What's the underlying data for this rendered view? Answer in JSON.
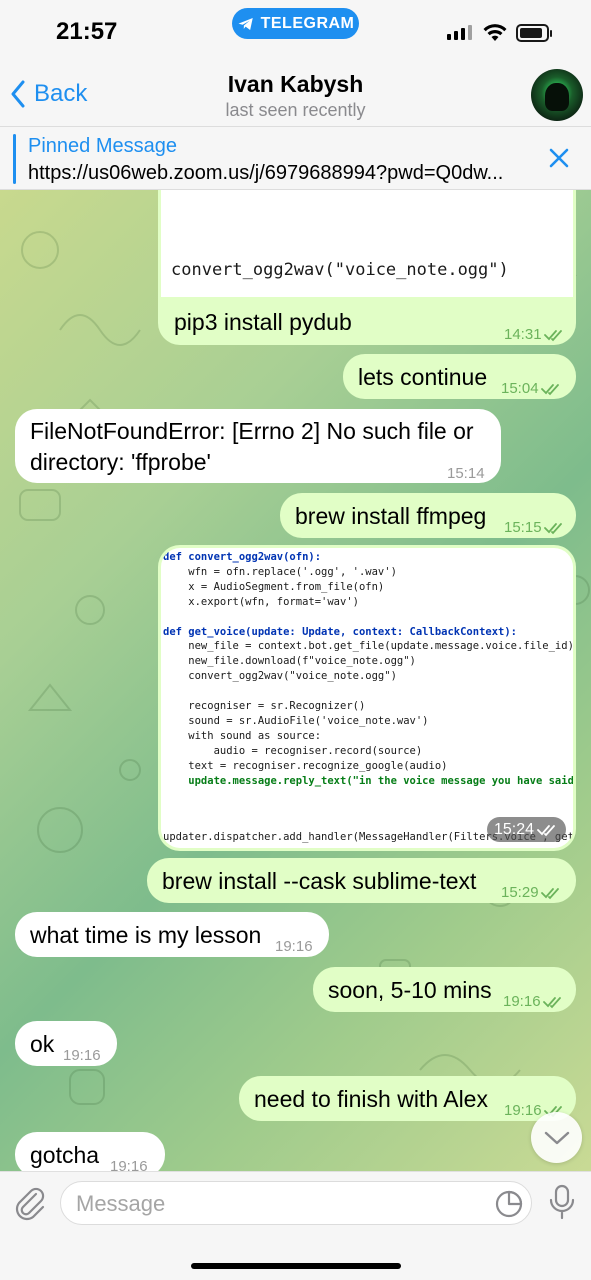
{
  "status_bar": {
    "time": "21:57",
    "app_pill": "TELEGRAM",
    "battery_level": 0.88
  },
  "header": {
    "back_label": "Back",
    "title": "Ivan Kabysh",
    "subtitle": "last seen recently"
  },
  "pinned": {
    "title": "Pinned Message",
    "text": "https://us06web.zoom.us/j/6979688994?pwd=Q0dw..."
  },
  "messages": {
    "code_top_line": "convert_ogg2wav(\"voice_note.ogg\")",
    "m1": {
      "text": "pip3 install pydub",
      "time": "14:31"
    },
    "m2": {
      "text": "lets continue",
      "time": "15:04"
    },
    "m3": {
      "line1": "FileNotFoundError: [Errno 2] No such file or",
      "line2": "directory: 'ffprobe'",
      "time": "15:14"
    },
    "m4": {
      "text": "brew install ffmpeg",
      "time": "15:15"
    },
    "m5_time": "15:24",
    "m6": {
      "text": "brew install --cask sublime-text",
      "time": "15:29"
    },
    "m7": {
      "text": "what time is my lesson",
      "time": "19:16"
    },
    "m8": {
      "text": "soon, 5-10 mins",
      "time": "19:16"
    },
    "m9": {
      "text": "ok",
      "time": "19:16"
    },
    "m10": {
      "text": "need to finish with Alex",
      "time": "19:16"
    },
    "m11": {
      "text": "gotcha",
      "time": "19:16"
    }
  },
  "code_image": {
    "l01": "def convert_ogg2wav(ofn):",
    "l02": "    wfn = ofn.replace('.ogg', '.wav')",
    "l03": "    x = AudioSegment.from_file(ofn)",
    "l04": "    x.export(wfn, format='wav')",
    "l05": "def get_voice(update: Update, context: CallbackContext):",
    "l06": "    new_file = context.bot.get_file(update.message.voice.file_id)",
    "l07": "    new_file.download(f\"voice_note.ogg\")",
    "l08": "    convert_ogg2wav(\"voice_note.ogg\")",
    "l09": "    recogniser = sr.Recognizer()",
    "l10": "    sound = sr.AudioFile('voice_note.wav')",
    "l11": "    with sound as source:",
    "l12": "        audio = recogniser.record(source)",
    "l13": "    text = recogniser.recognize_google(audio)",
    "l14": "    update.message.reply_text(\"in the voice message you have said: \\n\"+text)",
    "l15": "updater.dispatcher.add_handler(MessageHandler(Filters.voice , get_voice))"
  },
  "input": {
    "placeholder": "Message"
  },
  "colors": {
    "accent": "#1e8ff0",
    "outgoing_bubble": "#e1fec6",
    "incoming_bubble": "#ffffff",
    "read_check": "#6bb35b"
  },
  "icons": [
    "telegram-icon",
    "back-chevron-icon",
    "close-icon",
    "double-check-icon",
    "chevron-down-icon",
    "paperclip-icon",
    "sticker-icon",
    "microphone-icon"
  ]
}
